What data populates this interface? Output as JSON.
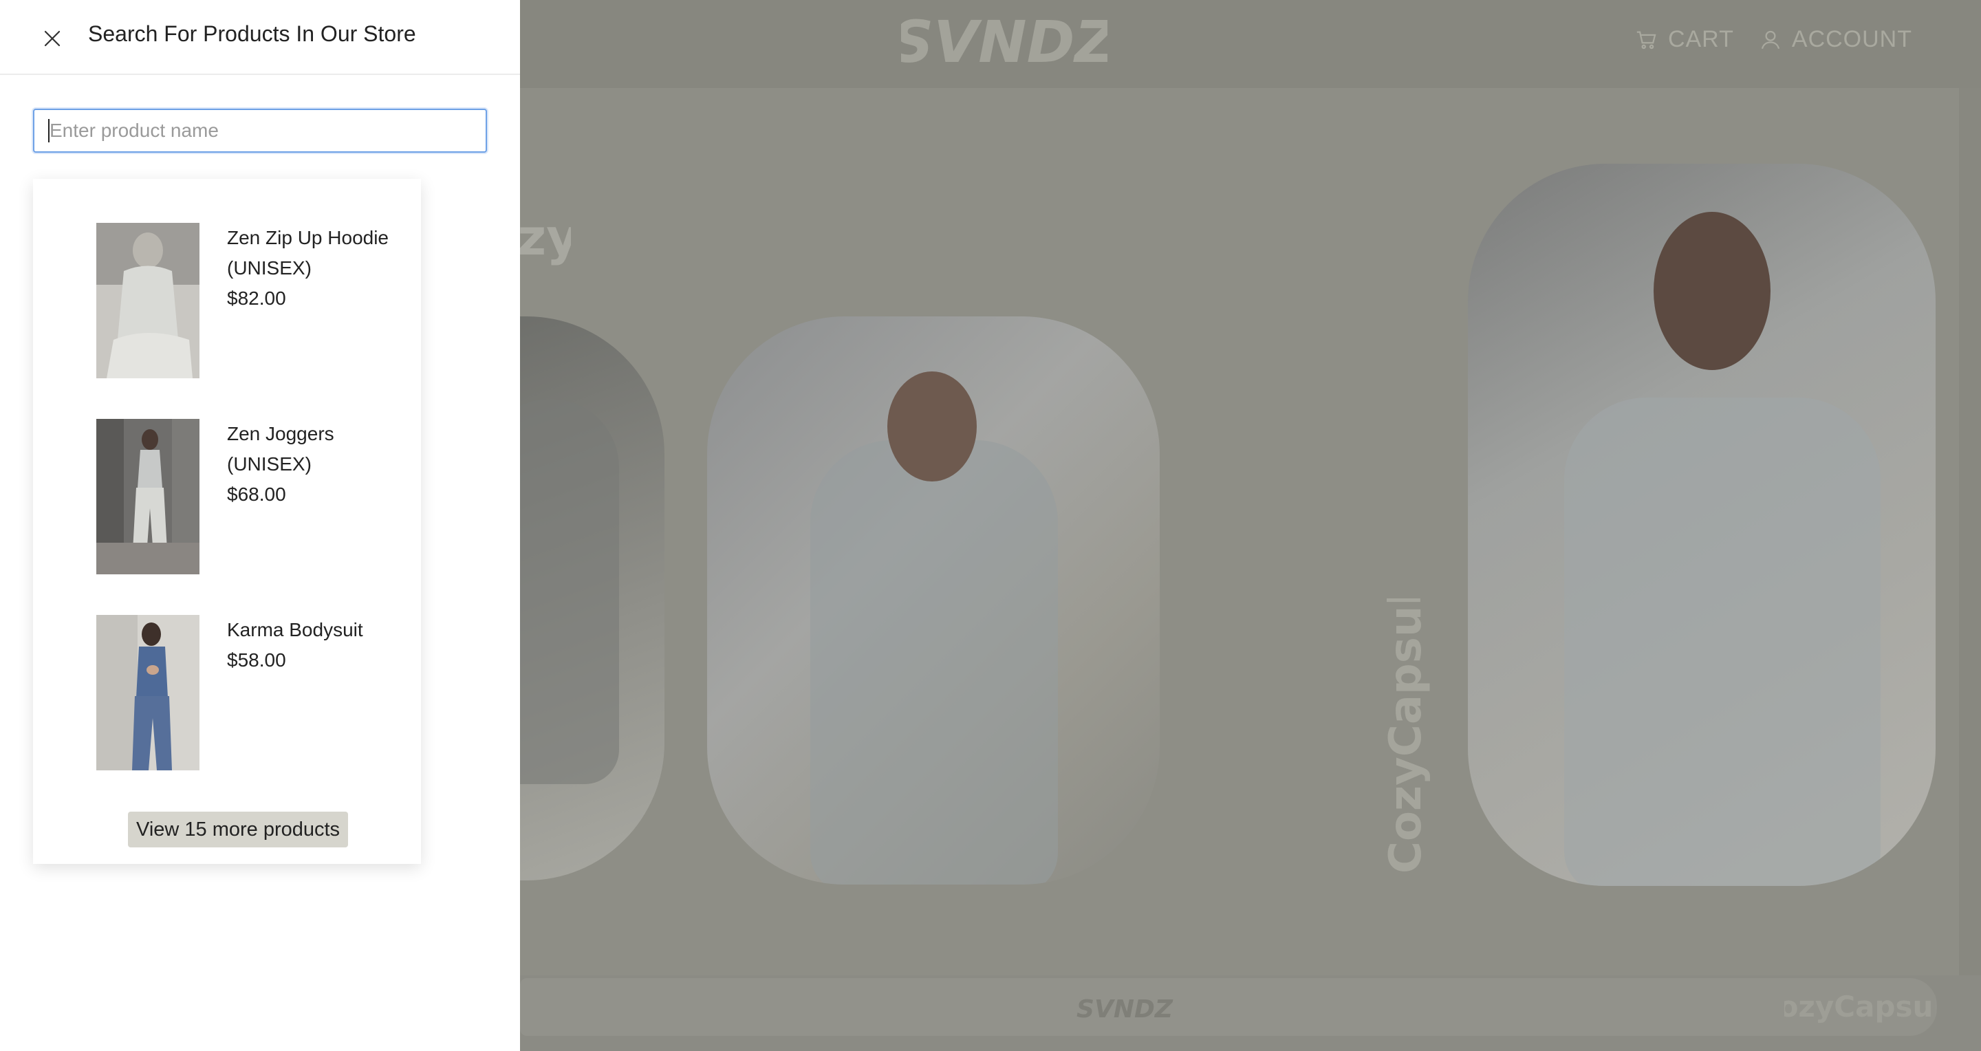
{
  "store": {
    "brand": "SVNDZ",
    "nav": {
      "cart_label": "CART",
      "account_label": "ACCOUNT"
    },
    "collection_word": "CozyCapsule",
    "footer_brand": "SVNDZ"
  },
  "drawer": {
    "title": "Search For Products In Our Store",
    "search": {
      "placeholder": "Enter product name",
      "value": ""
    },
    "results": [
      {
        "name": "Zen Zip Up Hoodie (UNISEX)",
        "price": "$82.00"
      },
      {
        "name": "Zen Joggers (UNISEX)",
        "price": "$68.00"
      },
      {
        "name": "Karma Bodysuit",
        "price": "$58.00"
      }
    ],
    "more_label": "View 15 more products"
  },
  "colors": {
    "overlay": "#8b8b84",
    "input_focus": "#6ea1e6",
    "more_button_bg": "#d6d5cd"
  },
  "icons": [
    "close-icon",
    "cart-icon",
    "account-icon"
  ]
}
